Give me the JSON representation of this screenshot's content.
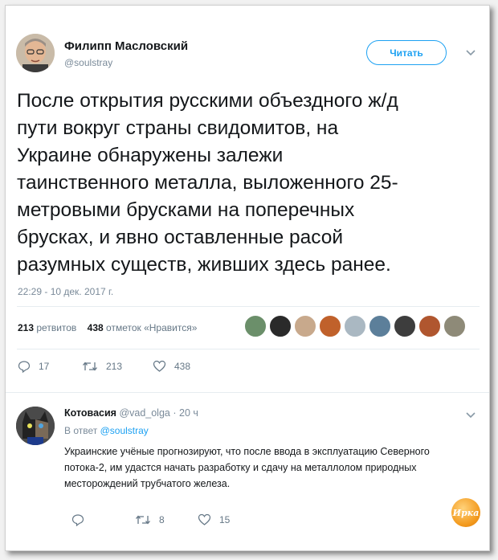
{
  "tweet": {
    "author_name": "Филипп Масловский",
    "author_handle": "@soulstray",
    "follow_label": "Читать",
    "text": "После открытия русскими объездного ж/д\nпути вокруг страны свидомитов, на\nУкраине обнаружены залежи\nтаинственного металла, выложенного 25-\nметровыми брусками на поперечных\nбрусках, и явно оставленные расой\nразумных существ, живших здесь ранее.",
    "timestamp": "22:29 - 10 дек. 2017 г.",
    "retweets_count": "213",
    "retweets_label": "ретвитов",
    "likes_count": "438",
    "likes_label": "отметок «Нравится»",
    "actions": {
      "reply_count": "17",
      "retweet_count": "213",
      "like_count": "438"
    }
  },
  "reply": {
    "author_name": "Котовасия",
    "author_handle": "@vad_olga",
    "time": "· 20 ч",
    "in_reply_prefix": "В ответ",
    "in_reply_handle": "@soulstray",
    "text": "Украинские учёные прогнозируют, что после ввода в эксплуатацию Северного потока-2, им удастся начать разработку и сдачу на металлолом природных месторождений трубчатого железа.",
    "actions": {
      "retweet_count": "8",
      "like_count": "15"
    },
    "watermark": "Ирка"
  },
  "colors": {
    "accent": "#1da1f2",
    "text": "#14171a",
    "muted": "#657786"
  }
}
